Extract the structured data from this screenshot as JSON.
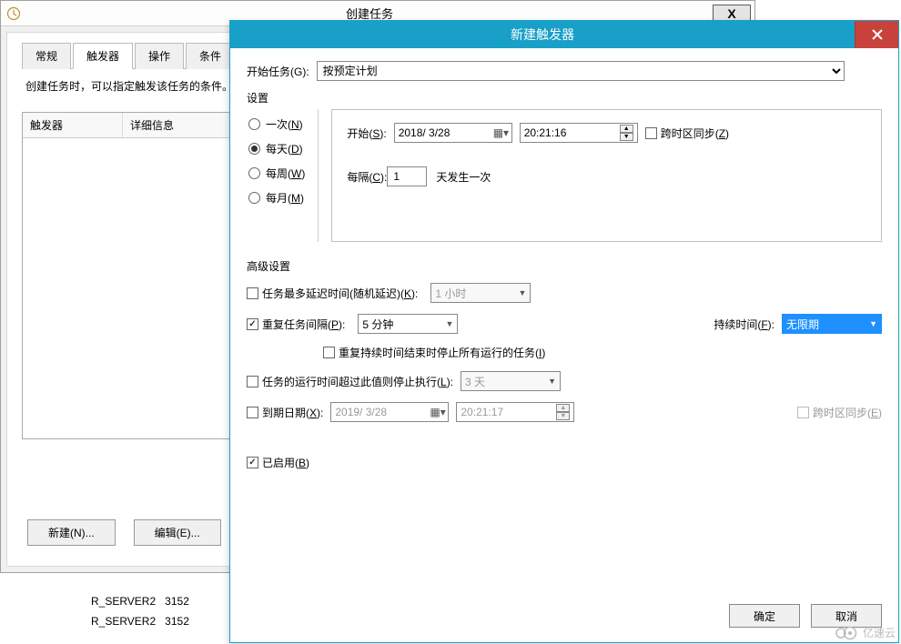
{
  "back": {
    "title": "创建任务",
    "close": "X",
    "tabs": [
      "常规",
      "触发器",
      "操作",
      "条件"
    ],
    "active_tab": 1,
    "desc": "创建任务时，可以指定触发该任务的条件。",
    "cols": [
      "触发器",
      "详细信息"
    ],
    "new_btn": "新建(N)...",
    "edit_btn": "编辑(E)..."
  },
  "bg": {
    "r1a": "R_SERVER2",
    "r1b": "3152",
    "r2a": "R_SERVER2",
    "r2b": "3152"
  },
  "front": {
    "title": "新建触发器",
    "begin_label": "开始任务(G):",
    "begin_value": "按预定计划",
    "settings_label": "设置",
    "freq_once": "一次(N)",
    "freq_daily": "每天(D)",
    "freq_weekly": "每周(W)",
    "freq_monthly": "每月(M)",
    "start_label": "开始(S):",
    "start_date": "2018/ 3/28",
    "start_time": "20:21:16",
    "sync_tz": "跨时区同步(Z)",
    "recur_label": "每隔(C):",
    "recur_value": "1",
    "recur_suffix": "天发生一次",
    "adv_label": "高级设置",
    "delay_label": "任务最多延迟时间(随机延迟)(K):",
    "delay_val": "1 小时",
    "repeat_label": "重复任务间隔(P):",
    "repeat_val": "5 分钟",
    "duration_label": "持续时间(F):",
    "duration_val": "无限期",
    "stop_repeat": "重复持续时间结束时停止所有运行的任务(I)",
    "stop_after_label": "任务的运行时间超过此值则停止执行(L):",
    "stop_after_val": "3 天",
    "expire_label": "到期日期(X):",
    "expire_date": "2019/ 3/28",
    "expire_time": "20:21:17",
    "expire_sync": "跨时区同步(E)",
    "enabled_label": "已启用(B)",
    "ok": "确定",
    "cancel": "取消"
  },
  "watermark": "亿速云"
}
